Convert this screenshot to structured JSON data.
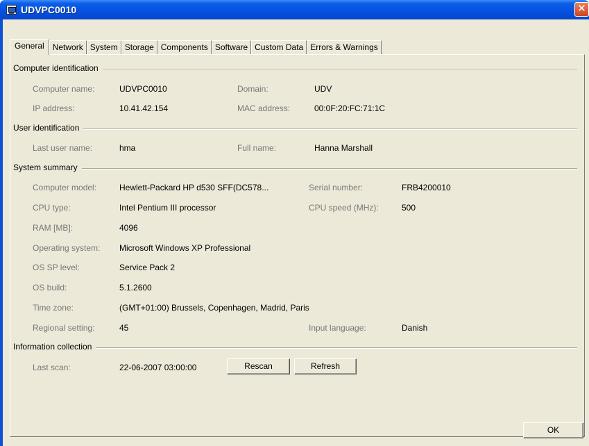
{
  "window": {
    "title": "UDVPC0010"
  },
  "tabs": [
    "General",
    "Network",
    "System",
    "Storage",
    "Components",
    "Software",
    "Custom Data",
    "Errors & Warnings"
  ],
  "sections": {
    "computer_identification": "Computer identification",
    "user_identification": "User identification",
    "system_summary": "System summary",
    "information_collection": "Information collection"
  },
  "computer": {
    "name_label": "Computer name:",
    "name": "UDVPC0010",
    "domain_label": "Domain:",
    "domain": "UDV",
    "ip_label": "IP address:",
    "ip": "10.41.42.154",
    "mac_label": "MAC address:",
    "mac": "00:0F:20:FC:71:1C"
  },
  "user": {
    "last_user_label": "Last user name:",
    "last_user": "hma",
    "full_name_label": "Full name:",
    "full_name": "Hanna Marshall"
  },
  "system": {
    "model_label": "Computer model:",
    "model": "Hewlett-Packard  HP  d530  SFF(DC578...",
    "serial_label": "Serial number:",
    "serial": "FRB4200010",
    "cpu_label": "CPU type:",
    "cpu": "Intel Pentium III processor",
    "cpu_speed_label": "CPU speed (MHz):",
    "cpu_speed": "500",
    "ram_label": "RAM [MB]:",
    "ram": "4096",
    "os_label": "Operating system:",
    "os": "Microsoft Windows XP Professional",
    "sp_label": "OS SP level:",
    "sp": "Service Pack 2",
    "build_label": "OS build:",
    "build": "5.1.2600",
    "tz_label": "Time zone:",
    "tz": "(GMT+01:00) Brussels, Copenhagen, Madrid, Paris",
    "regional_label": "Regional setting:",
    "regional": "45",
    "input_lang_label": "Input language:",
    "input_lang": "Danish"
  },
  "collection": {
    "last_scan_label": "Last scan:",
    "last_scan": "22-06-2007 03:00:00",
    "rescan_label": "Rescan",
    "refresh_label": "Refresh"
  },
  "footer": {
    "ok_label": "OK"
  },
  "colors": {
    "titlebar": "#0551e0",
    "face": "#ece9d8",
    "label": "#777777",
    "close": "#d0451f"
  }
}
